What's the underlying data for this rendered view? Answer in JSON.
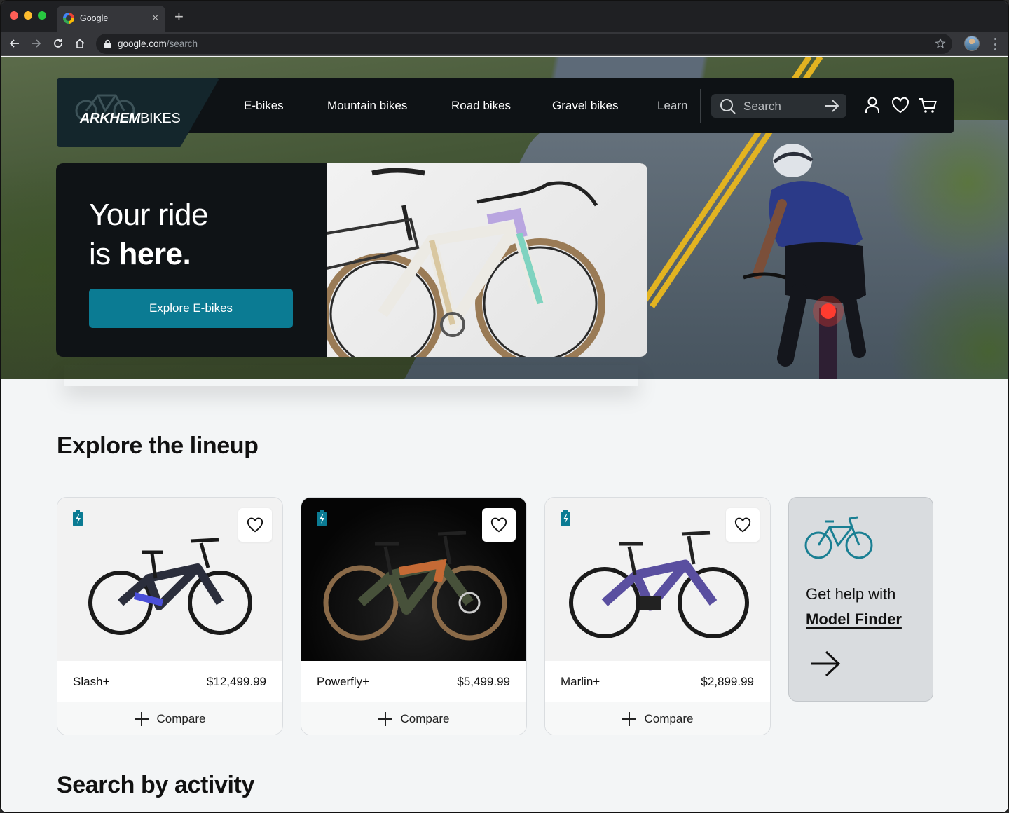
{
  "browser": {
    "tab_title": "Google",
    "tab_close": "×",
    "new_tab": "+",
    "url_host": "google.com",
    "url_path": "/search"
  },
  "site": {
    "logo_bold": "ARKHEM",
    "logo_light": "BIKES",
    "nav": [
      "E-bikes",
      "Mountain bikes",
      "Road bikes",
      "Gravel bikes",
      "Learn"
    ],
    "search_placeholder": "Search"
  },
  "hero": {
    "line1": "Your ride",
    "line2_plain": "is ",
    "line2_bold": "here.",
    "cta": "Explore E-bikes"
  },
  "lineup": {
    "title": "Explore the lineup",
    "compare_label": "Compare",
    "products": [
      {
        "name": "Slash+",
        "price": "$12,499.99"
      },
      {
        "name": "Powerfly+",
        "price": "$5,499.99"
      },
      {
        "name": "Marlin+",
        "price": "$2,899.99"
      }
    ],
    "finder_line1": "Get help with",
    "finder_link": "Model Finder"
  },
  "activity": {
    "title": "Search by activity"
  },
  "colors": {
    "accent": "#0b7b93",
    "nav_bg": "#0e1215",
    "finder_icon": "#1a7f93"
  },
  "icons": [
    "google-favicon",
    "back-arrow-icon",
    "forward-arrow-icon",
    "reload-icon",
    "home-icon",
    "lock-icon",
    "star-icon",
    "profile-avatar",
    "more-icon",
    "search-icon",
    "arrow-right-icon",
    "user-icon",
    "heart-icon",
    "cart-icon",
    "battery-icon",
    "plus-icon",
    "bike-icon"
  ]
}
